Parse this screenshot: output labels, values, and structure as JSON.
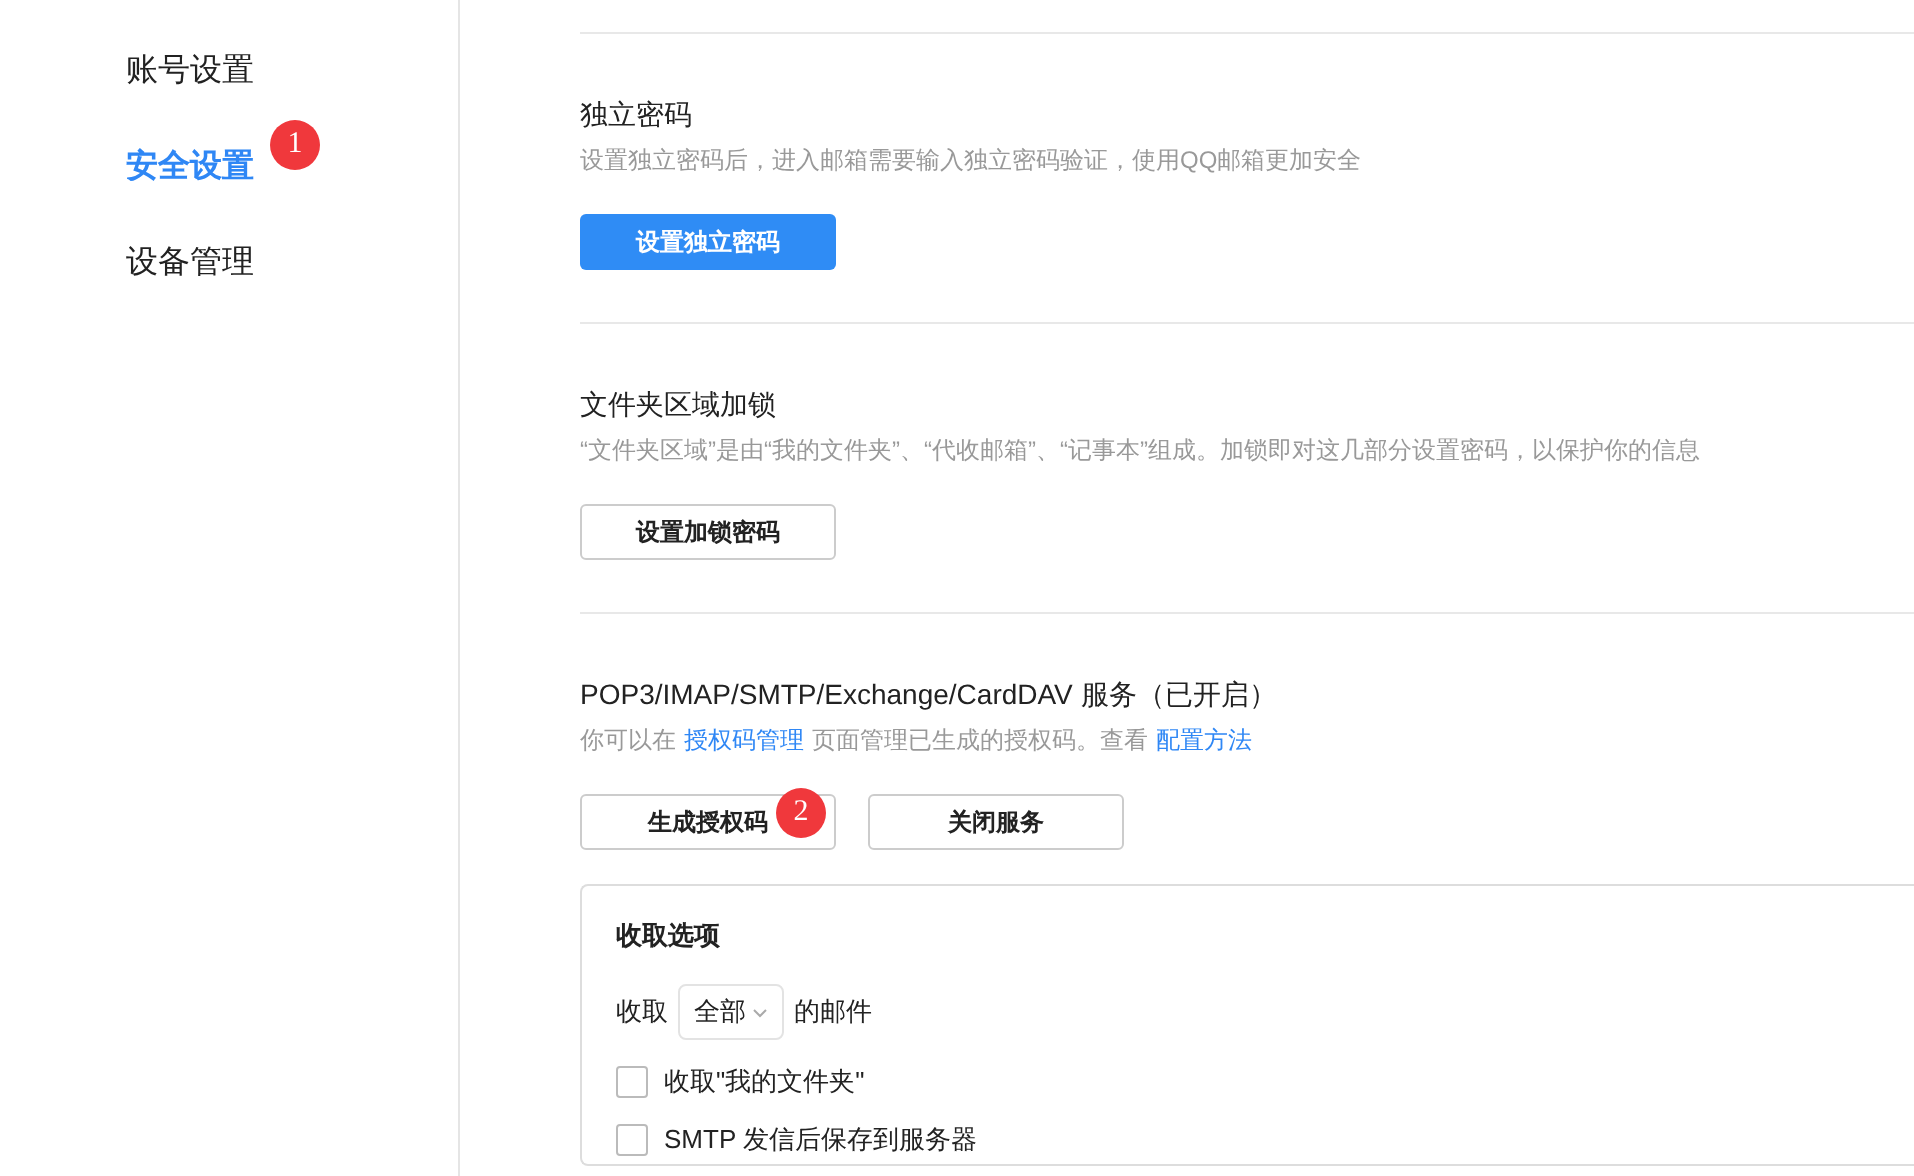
{
  "sidebar": {
    "items": [
      {
        "label": "账号设置",
        "selected": false
      },
      {
        "label": "安全设置",
        "selected": true,
        "badge": "1"
      },
      {
        "label": "设备管理",
        "selected": false
      }
    ]
  },
  "sections": [
    {
      "title": "独立密码",
      "description": "设置独立密码后，进入邮箱需要输入独立密码验证，使用QQ邮箱更加安全",
      "buttons": [
        {
          "label": "设置独立密码",
          "primary": true
        }
      ]
    },
    {
      "title": "文件夹区域加锁",
      "description": "“文件夹区域”是由“我的文件夹”、“代收邮箱”、“记事本”组成。加锁即对这几部分设置密码，以保护你的信息",
      "buttons": [
        {
          "label": "设置加锁密码",
          "primary": false
        }
      ]
    },
    {
      "title": "POP3/IMAP/SMTP/Exchange/CardDAV 服务（已开启）",
      "description_parts": [
        {
          "text": "你可以在",
          "link": false
        },
        {
          "text": "授权码管理",
          "link": true
        },
        {
          "text": "页面管理已生成的授权码。查看",
          "link": false
        },
        {
          "text": "配置方法",
          "link": true
        }
      ],
      "buttons": [
        {
          "label": "生成授权码",
          "primary": false,
          "badge": "2"
        },
        {
          "label": "关闭服务",
          "primary": false
        }
      ]
    }
  ],
  "receive_options": {
    "title": "收取选项",
    "prefix": "收取",
    "select_value": "全部",
    "suffix": "的邮件",
    "checkboxes": [
      {
        "label": "收取\"我的文件夹\"",
        "checked": false
      },
      {
        "label": "SMTP 发信后保存到服务器",
        "checked": false
      }
    ]
  }
}
